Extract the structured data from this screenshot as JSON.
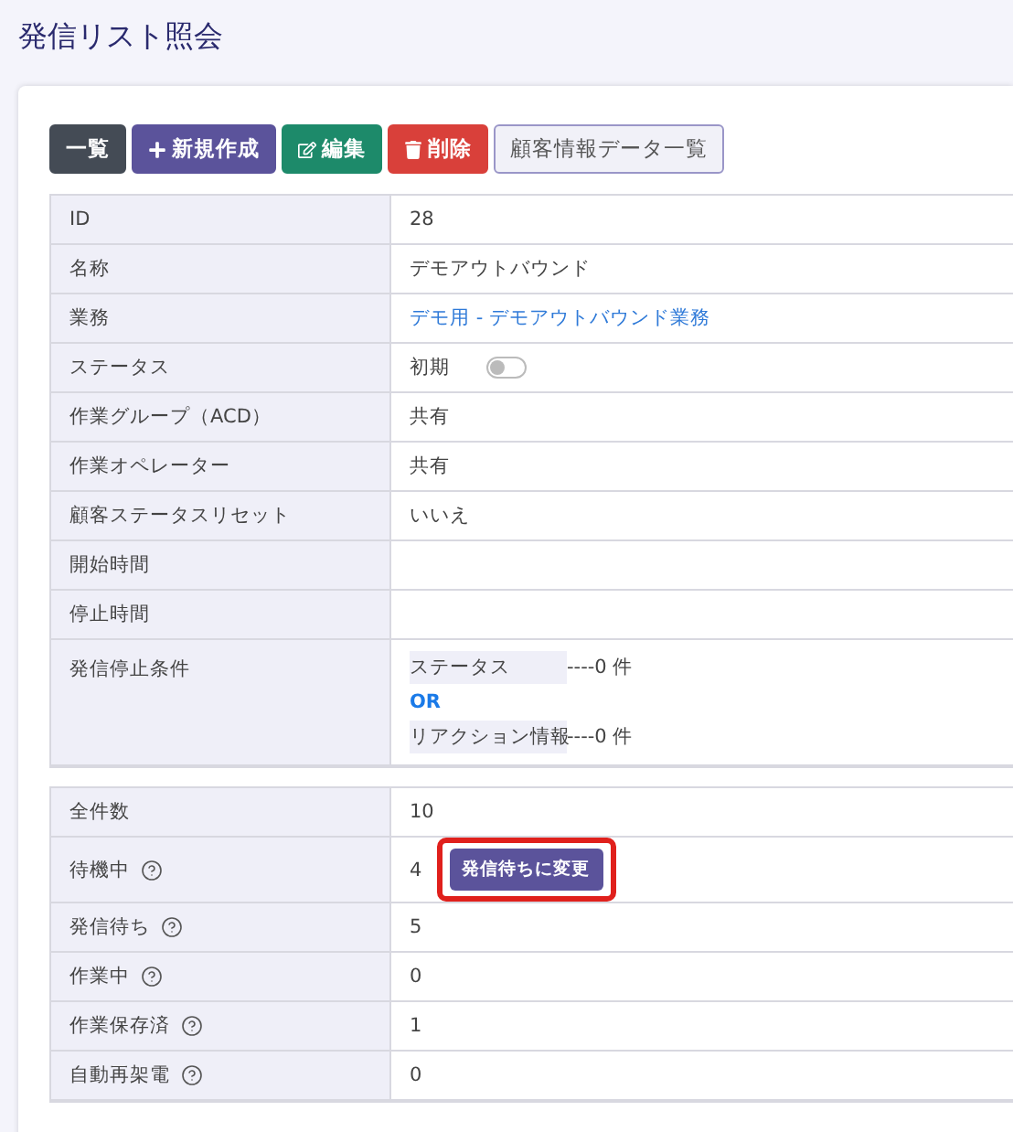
{
  "page_title": "発信リスト照会",
  "toolbar": [
    {
      "kind": "list",
      "label": "一覧"
    },
    {
      "kind": "create",
      "label": "新規作成"
    },
    {
      "kind": "edit",
      "label": "編集"
    },
    {
      "kind": "delete",
      "label": "削除"
    },
    {
      "kind": "outline",
      "label": "顧客情報データ一覧"
    }
  ],
  "details": [
    {
      "kind": "text",
      "label": "ID",
      "value": "28"
    },
    {
      "kind": "text",
      "label": "名称",
      "value": "デモアウトバウンド"
    },
    {
      "kind": "link",
      "label": "業務",
      "value": "デモ用 - デモアウトバウンド業務"
    },
    {
      "kind": "toggle",
      "label": "ステータス",
      "value": "初期",
      "on": false
    },
    {
      "kind": "text",
      "label": "作業グループ（ACD）",
      "value": "共有"
    },
    {
      "kind": "text",
      "label": "作業オペレーター",
      "value": "共有"
    },
    {
      "kind": "text",
      "label": "顧客ステータスリセット",
      "value": "いいえ"
    },
    {
      "kind": "text",
      "label": "開始時間"
    },
    {
      "kind": "text",
      "label": "停止時間"
    },
    {
      "kind": "conditions",
      "label": "発信停止条件",
      "conditions": [
        {
          "name": "ステータス",
          "count": "----0  件"
        },
        {
          "name": "リアクション情報",
          "count": "----0 件"
        }
      ],
      "operator": "OR"
    }
  ],
  "counts": [
    {
      "label": "全件数",
      "help": false,
      "value": "10"
    },
    {
      "label": "待機中",
      "help": true,
      "value": "4",
      "action": {
        "label": "発信待ちに変更",
        "highlighted": true
      }
    },
    {
      "label": "発信待ち",
      "help": true,
      "value": "5"
    },
    {
      "label": "作業中",
      "help": true,
      "value": "0"
    },
    {
      "label": "作業保存済",
      "help": true,
      "value": "1"
    },
    {
      "label": "自動再架電",
      "help": true,
      "value": "0"
    }
  ]
}
